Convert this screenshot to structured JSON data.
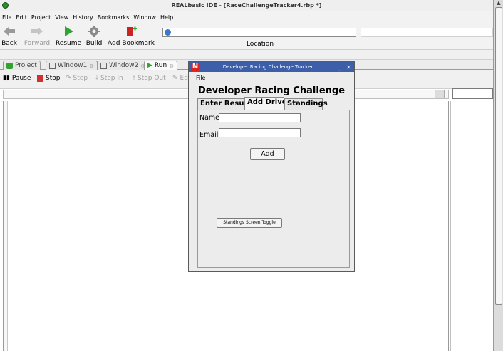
{
  "window": {
    "title": "REALbasic IDE - [RaceChallengeTracker4.rbp *]"
  },
  "menubar": [
    "File",
    "Edit",
    "Project",
    "View",
    "History",
    "Bookmarks",
    "Window",
    "Help"
  ],
  "toolbar": {
    "back": "Back",
    "forward": "Forward",
    "resume": "Resume",
    "build": "Build",
    "add_bookmark": "Add Bookmark",
    "location_label": "Location",
    "location_value": ""
  },
  "tabs": [
    "Project",
    "Window1",
    "Window2",
    "Run"
  ],
  "debug": {
    "pause": "Pause",
    "stop": "Stop",
    "step": "Step",
    "step_in": "Step In",
    "step_out": "Step Out",
    "edit": "Ed"
  },
  "app_window": {
    "title": "Developer Racing Challenge Tracker",
    "menu_file": "File",
    "heading": "Developer Racing Challenge",
    "tabs": [
      "Enter Results",
      "Add Driver",
      "Standings"
    ],
    "active_tab": "Add Driver",
    "name_label": "Name",
    "email_label": "Email",
    "add_button": "Add",
    "toggle_button": "Standings Screen Toggle"
  },
  "colors": {
    "app_titlebar": "#3d5ea8",
    "run_green": "#2ea42e",
    "stop_red": "#d03030"
  }
}
